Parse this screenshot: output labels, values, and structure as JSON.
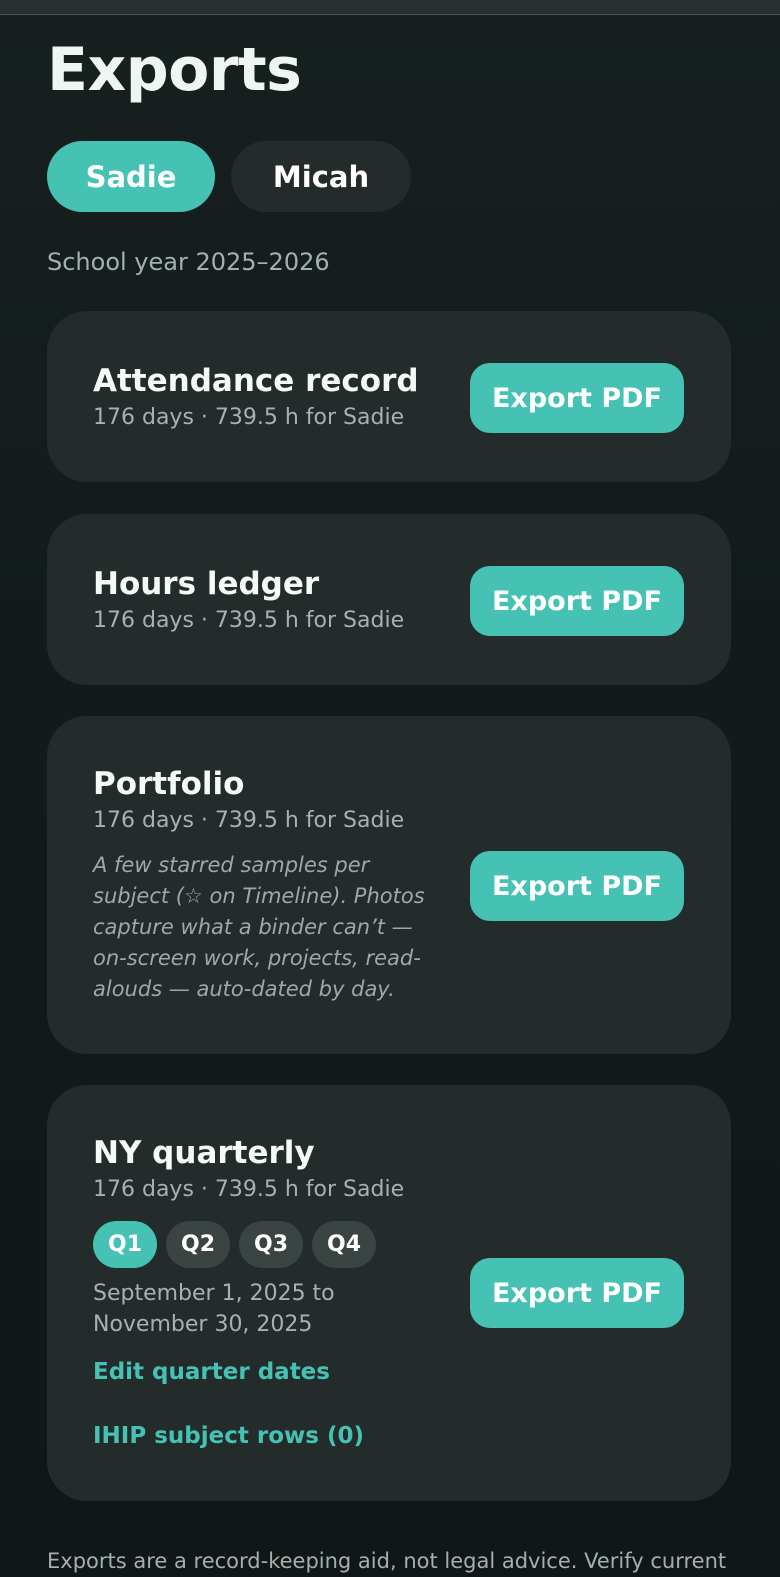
{
  "page": {
    "title": "Exports",
    "school_year": "School year 2025–2026"
  },
  "students": [
    {
      "name": "Sadie",
      "selected": true
    },
    {
      "name": "Micah",
      "selected": false
    }
  ],
  "cards": {
    "attendance": {
      "title": "Attendance record",
      "meta": "176 days · 739.5 h for Sadie",
      "button": "Export PDF"
    },
    "hours": {
      "title": "Hours ledger",
      "meta": "176 days · 739.5 h for Sadie",
      "button": "Export PDF"
    },
    "portfolio": {
      "title": "Portfolio",
      "meta": "176 days · 739.5 h for Sadie",
      "description": "A few starred samples per subject (☆ on Timeline). Photos capture what a binder can’t — on-screen work, projects, read-alouds — auto-dated by day.",
      "button": "Export PDF"
    },
    "quarterly": {
      "title": "NY quarterly",
      "meta": "176 days · 739.5 h for Sadie",
      "quarters": [
        "Q1",
        "Q2",
        "Q3",
        "Q4"
      ],
      "selected_quarter": "Q1",
      "date_range": "September 1, 2025 to November 30, 2025",
      "edit_link": "Edit quarter dates",
      "ihip_link": "IHIP subject rows (0)",
      "button": "Export PDF"
    }
  },
  "footer": {
    "note": "Exports are a record-keeping aid, not legal advice. Verify current"
  },
  "colors": {
    "accent": "#45c2b4",
    "card_bg": "#232b2b",
    "page_bg": "#131c1b"
  }
}
